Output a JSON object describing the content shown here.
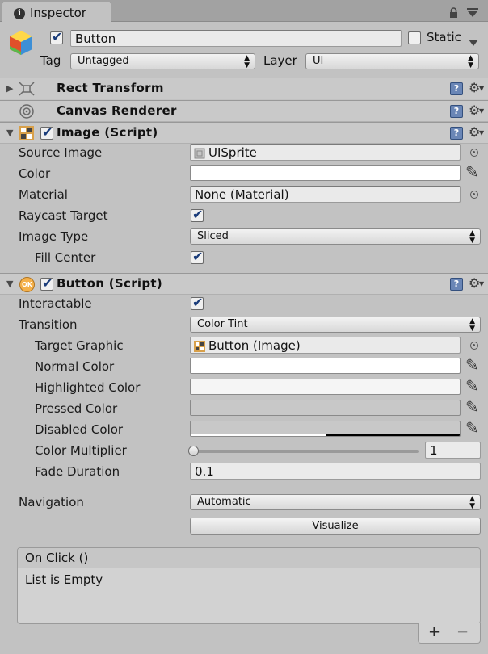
{
  "tab": {
    "title": "Inspector",
    "info_glyph": "i"
  },
  "header": {
    "active": true,
    "name": "Button",
    "static_label": "Static",
    "static_checked": false,
    "tag_label": "Tag",
    "tag_value": "Untagged",
    "layer_label": "Layer",
    "layer_value": "UI"
  },
  "components": {
    "rect_transform": "Rect Transform",
    "canvas_renderer": "Canvas Renderer",
    "image": {
      "title": "Image (Script)",
      "source_image_label": "Source Image",
      "source_image_value": "UISprite",
      "color_label": "Color",
      "color_value": "#ffffff",
      "material_label": "Material",
      "material_value": "None (Material)",
      "raycast_label": "Raycast Target",
      "raycast_checked": true,
      "image_type_label": "Image Type",
      "image_type_value": "Sliced",
      "fill_center_label": "Fill Center",
      "fill_center_checked": true
    },
    "button": {
      "title": "Button (Script)",
      "ok_badge": "OK",
      "interactable_label": "Interactable",
      "interactable_checked": true,
      "transition_label": "Transition",
      "transition_value": "Color Tint",
      "target_graphic_label": "Target Graphic",
      "target_graphic_value": "Button (Image)",
      "normal_color_label": "Normal Color",
      "normal_color": "#ffffff",
      "highlighted_color_label": "Highlighted Color",
      "highlighted_color": "#f5f5f5",
      "pressed_color_label": "Pressed Color",
      "pressed_color": "#c8c8c8",
      "disabled_color_label": "Disabled Color",
      "disabled_color": "#c8c8c8",
      "disabled_alpha": 0.5,
      "color_multiplier_label": "Color Multiplier",
      "color_multiplier_value": "1",
      "color_multiplier_fraction": 0.0,
      "fade_duration_label": "Fade Duration",
      "fade_duration_value": "0.1",
      "navigation_label": "Navigation",
      "navigation_value": "Automatic",
      "visualize_label": "Visualize",
      "onclick_label": "On Click ()",
      "onclick_empty": "List is Empty",
      "add_label": "+",
      "remove_label": "−"
    }
  },
  "colors": {
    "panel": "#c2c2c2",
    "help_icon": "#6a86b6",
    "check": "#1a3c7a"
  }
}
